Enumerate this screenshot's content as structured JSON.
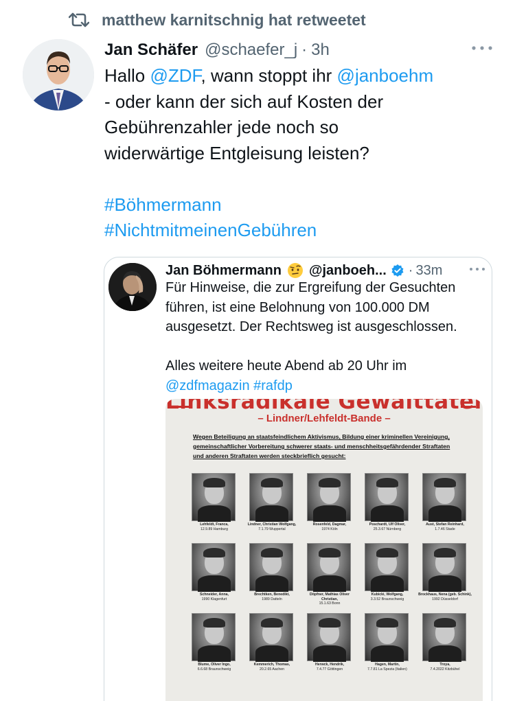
{
  "retweet": {
    "icon": "retweet-icon",
    "text": "matthew karnitschnig hat retweetet"
  },
  "tweet": {
    "author_name": "Jan Schäfer",
    "handle": "@schaefer_j",
    "separator": "·",
    "time": "3h",
    "more_icon": "more-horizontal-icon",
    "body": {
      "l1_pre": "Hallo ",
      "l1_mention1": "@ZDF",
      "l1_mid": ", wann stoppt ihr ",
      "l1_mention2": "@janboehm",
      "l2": "- oder kann der sich auf Kosten der",
      "l3": "Gebührenzahler jede noch so",
      "l4": "widerwärtige Entgleisung leisten?",
      "hashtag1": "#Böhmermann",
      "hashtag2": "#NichtmitmeinenGebühren"
    }
  },
  "quote": {
    "author_name": "Jan Böhmermann",
    "emoji_icon": "raised-eyebrow-emoji-icon",
    "handle": "@janboeh...",
    "verified_icon": "verified-badge-icon",
    "separator": "·",
    "time": "33m",
    "more_icon": "more-horizontal-icon",
    "body": {
      "l1": "Für Hinweise, die zur Ergreifung der Gesuchten",
      "l2": "führen, ist eine Belohnung von 100.000 DM",
      "l3": "ausgesetzt. Der Rechtsweg ist ausgeschlossen.",
      "l4": "Alles weitere heute Abend ab 20 Uhr im",
      "l5_mention": "@zdfmagazin",
      "l5_space": " ",
      "l5_hashtag": "#rafdp"
    },
    "poster": {
      "title": "Linksradikale Gewalttäter",
      "subtitle": "– Lindner/Lehfeldt-Bande –",
      "notice_l1": "Wegen Beteiligung an staatsfeindlichem Aktivismus, Bildung einer kriminellen Vereinigung,",
      "notice_l2": "gemeinschaftlicher Vorbereitung schwerer staats- und menschheitsgefährdender Straftaten",
      "notice_l3": "und anderen Straftaten werden steckbrieflich gesucht:",
      "people": [
        {
          "name": "Lehfeldt, Franca,",
          "detail": "12.9.89 Hamburg"
        },
        {
          "name": "Lindner, Christian Wolfgang,",
          "detail": "7.1.79 Wuppertal"
        },
        {
          "name": "Rosenfeld, Dagmar,",
          "detail": "1974 Köln"
        },
        {
          "name": "Poschardt, Ulf Oliver,",
          "detail": "25.3.67 Nürnberg"
        },
        {
          "name": "Aust, Stefan Reinhard,",
          "detail": "1.7.46 Stade"
        },
        {
          "name": "Schneider, Anna,",
          "detail": "1990 Klagenfurt"
        },
        {
          "name": "Brechtken, Benedikt,",
          "detail": "1989 Datteln"
        },
        {
          "name": "Döpfner, Mathias Oliver Christian,",
          "detail": "15.1.63 Bonn"
        },
        {
          "name": "Kubicki, Wolfgang,",
          "detail": "3.3.52 Braunschweig"
        },
        {
          "name": "Brockhaus, Nena (geb. Schink),",
          "detail": "1992 Düsseldorf"
        },
        {
          "name": "Blume, Oliver Ingo,",
          "detail": "6.6.68 Braunschweig"
        },
        {
          "name": "Kemmerich, Thomas,",
          "detail": "20.2.65 Aachen"
        },
        {
          "name": "Herwck, Hendrik,",
          "detail": "7.4.77 Göttingen"
        },
        {
          "name": "Hagen, Martin,",
          "detail": "7.7.81 La Spezia (Italien)"
        },
        {
          "name": "Troya,",
          "detail": "7.4.2022 Kitzbühel"
        }
      ]
    }
  }
}
